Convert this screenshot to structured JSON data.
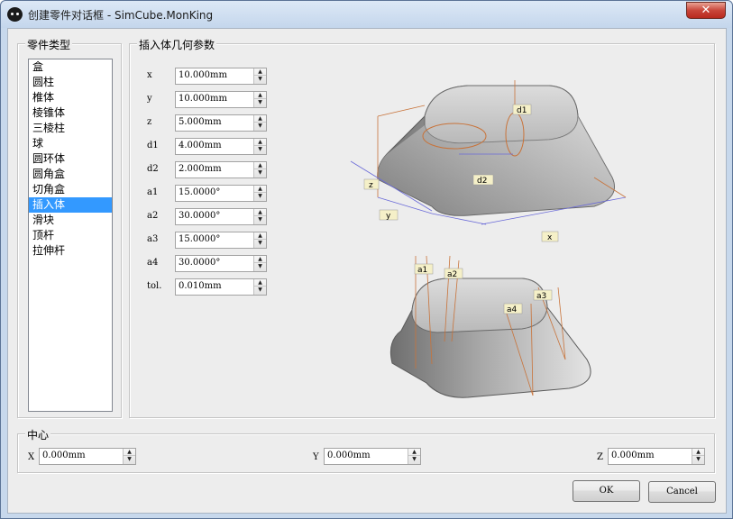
{
  "window": {
    "title": "创建零件对话框 - SimCube.MonKing",
    "close_glyph": "✕"
  },
  "part_type": {
    "legend": "零件类型",
    "items": [
      "盒",
      "圆柱",
      "椎体",
      "棱锥体",
      "三棱柱",
      "球",
      "圆环体",
      "圆角盒",
      "切角盒",
      "插入体",
      "滑块",
      "顶杆",
      "拉伸杆"
    ],
    "selected_index": 9
  },
  "geometry": {
    "legend": "插入体几何参数",
    "params": [
      {
        "label": "x",
        "value": "10.000mm"
      },
      {
        "label": "y",
        "value": "10.000mm"
      },
      {
        "label": "z",
        "value": "5.000mm"
      },
      {
        "label": "d1",
        "value": "4.000mm"
      },
      {
        "label": "d2",
        "value": "2.000mm"
      },
      {
        "label": "a1",
        "value": "15.0000°"
      },
      {
        "label": "a2",
        "value": "30.0000°"
      },
      {
        "label": "a3",
        "value": "15.0000°"
      },
      {
        "label": "a4",
        "value": "30.0000°"
      },
      {
        "label": "tol.",
        "value": "0.010mm"
      }
    ],
    "diagram_labels": {
      "d1": "d1",
      "d2": "d2",
      "z": "z",
      "y": "y",
      "x": "x",
      "a1": "a1",
      "a2": "a2",
      "a3": "a3",
      "a4": "a4"
    }
  },
  "center": {
    "legend": "中心",
    "x_label": "X",
    "x_value": "0.000mm",
    "y_label": "Y",
    "y_value": "0.000mm",
    "z_label": "Z",
    "z_value": "0.000mm"
  },
  "buttons": {
    "ok": "OK",
    "cancel": "Cancel"
  },
  "colors": {
    "selection": "#3399ff",
    "dimension_lines": "#c8733a",
    "close_button": "#c9463a"
  }
}
